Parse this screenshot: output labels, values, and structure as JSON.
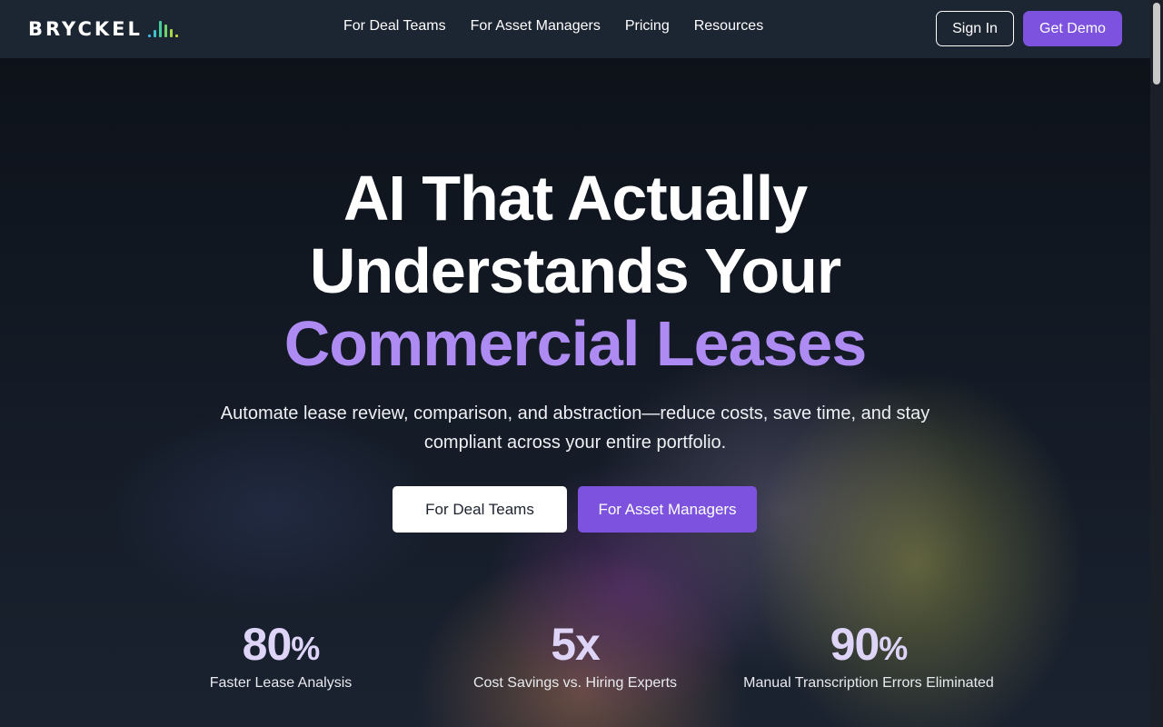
{
  "brand": {
    "name": "BRYCKEL",
    "mark_icon": "bar-signal-icon",
    "mark_colors": [
      "#3fb6e8",
      "#3fc2c8",
      "#45cc9a",
      "#6fd26a",
      "#a6d64a",
      "#c9d83a"
    ]
  },
  "nav": {
    "links": [
      "For Deal Teams",
      "For Asset Managers",
      "Pricing",
      "Resources"
    ],
    "sign_in": "Sign In",
    "get_demo": "Get Demo"
  },
  "hero": {
    "title_line1": "AI That Actually",
    "title_line2": "Understands Your",
    "title_accent": "Commercial Leases",
    "subtitle": "Automate lease review, comparison, and abstraction—reduce costs, save time, and stay compliant across your entire portfolio.",
    "cta_primary": "For Deal Teams",
    "cta_secondary": "For Asset Managers"
  },
  "stats": [
    {
      "value": "80",
      "unit": "%",
      "label": "Faster Lease Analysis"
    },
    {
      "value": "5x",
      "unit": "",
      "label": "Cost Savings vs. Hiring Experts"
    },
    {
      "value": "90",
      "unit": "%",
      "label": "Manual Transcription Errors Eliminated"
    }
  ],
  "colors": {
    "accent": "#7c52de",
    "accent_text": "#ad8bf2",
    "nav_bg": "#1c2532",
    "stat_value": "#ddd4f7"
  }
}
